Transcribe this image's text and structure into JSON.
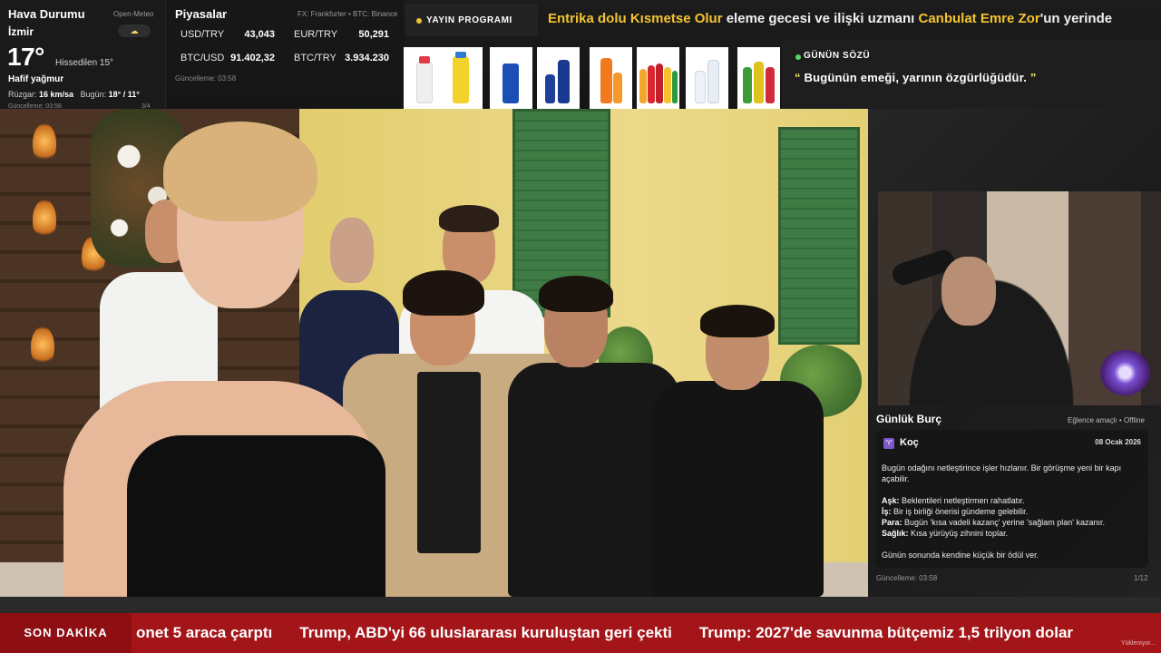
{
  "weather": {
    "title": "Hava Durumu",
    "source": "Open-Meteo",
    "icon": "cloud-rain-icon",
    "icon_glyph": "☁",
    "city": "İzmir",
    "temperature": "17°",
    "feels_like": "Hissedilen 15°",
    "condition": "Hafif yağmur",
    "wind_label": "Rüzgar:",
    "wind_value": "16 km/sa",
    "today_label": "Bugün:",
    "today_value": "18° / 11°",
    "updated": "Güncelleme: 03:58",
    "page": "3/4"
  },
  "markets": {
    "title": "Piyasalar",
    "source": "FX: Frankfurter • BTC: Binance",
    "rows": [
      {
        "label": "USD/TRY",
        "value": "43,043"
      },
      {
        "label": "EUR/TRY",
        "value": "50,291"
      },
      {
        "label": "BTC/USD",
        "value": "91.402,32"
      },
      {
        "label": "BTC/TRY",
        "value": "3.934.230"
      }
    ],
    "updated": "Güncelleme: 03:58"
  },
  "schedule": {
    "label": "YAYIN PROGRAMI"
  },
  "headline": {
    "part1": "Entrika dolu Kısmetse Olur",
    "part2": " eleme gecesi ve ilişki uzmanı ",
    "part3": "Canbulat Emre Zor",
    "part4": "'un yerinde"
  },
  "products": [
    {
      "name": "water-bottle-product"
    },
    {
      "name": "lemon-drink-product"
    },
    {
      "name": "blue-can-product"
    },
    {
      "name": "blue-bottles-product"
    },
    {
      "name": "orange-drink-product"
    },
    {
      "name": "soda-pack-product"
    },
    {
      "name": "water-pack-product"
    },
    {
      "name": "green-bottles-product"
    }
  ],
  "quote": {
    "title": "GÜNÜN SÖZÜ",
    "open": "“",
    "text": " Bugünün emeği, yarının özgürlüğüdür. ",
    "close": "”"
  },
  "horoscope": {
    "title": "Günlük Burç",
    "mode": "Eğlence amaçlı • Offline",
    "sign": "Koç",
    "sign_icon": "aries-icon",
    "date": "08 Ocak 2026",
    "intro": "Bugün odağını netleştirince işler hızlanır. Bir görüşme yeni bir kapı açabilir.",
    "love_label": "Aşk:",
    "love": " Beklentileri netleştirmen rahatlatır.",
    "work_label": "İş:",
    "work": " Bir iş birliği önerisi gündeme gelebilir.",
    "money_label": "Para:",
    "money": " Bugün 'kısa vadeli kazanç' yerine 'sağlam plan' kazanır.",
    "health_label": "Sağlık:",
    "health": " Kısa yürüyüş zihnini toplar.",
    "closing": "Günün sonunda kendine küçük bir ödül ver.",
    "updated": "Güncelleme: 03:58",
    "page": "1/12"
  },
  "ticker": {
    "label": "SON DAKİKA",
    "items": [
      "onet 5 araca çarptı",
      "Trump, ABD'yi 66 uluslararası kuruluştan geri çekti",
      "Trump: 2027'de savunma bütçemiz 1,5 trilyon dolar"
    ],
    "loading": "Yükleniyor..."
  },
  "colors": {
    "accent_yellow": "#f4c430",
    "ticker_red": "#a31519",
    "live_green": "#53d769"
  }
}
